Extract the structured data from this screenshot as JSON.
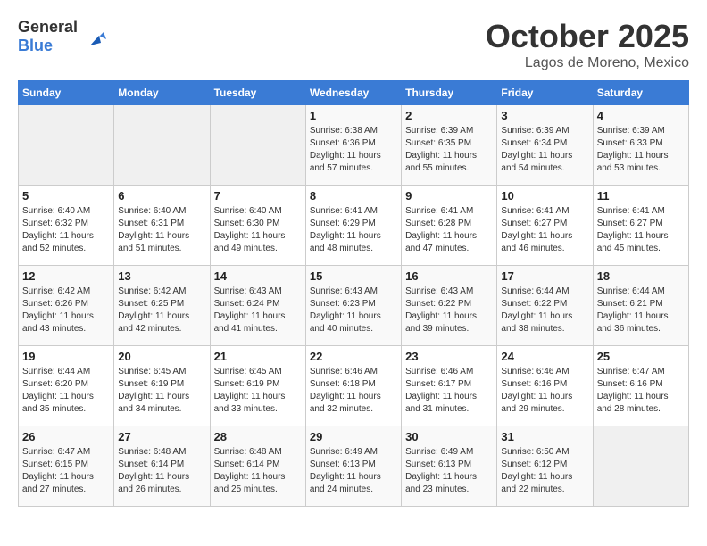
{
  "header": {
    "logo_general": "General",
    "logo_blue": "Blue",
    "month": "October 2025",
    "location": "Lagos de Moreno, Mexico"
  },
  "days_of_week": [
    "Sunday",
    "Monday",
    "Tuesday",
    "Wednesday",
    "Thursday",
    "Friday",
    "Saturday"
  ],
  "weeks": [
    [
      {
        "day": "",
        "info": ""
      },
      {
        "day": "",
        "info": ""
      },
      {
        "day": "",
        "info": ""
      },
      {
        "day": "1",
        "info": "Sunrise: 6:38 AM\nSunset: 6:36 PM\nDaylight: 11 hours and 57 minutes."
      },
      {
        "day": "2",
        "info": "Sunrise: 6:39 AM\nSunset: 6:35 PM\nDaylight: 11 hours and 55 minutes."
      },
      {
        "day": "3",
        "info": "Sunrise: 6:39 AM\nSunset: 6:34 PM\nDaylight: 11 hours and 54 minutes."
      },
      {
        "day": "4",
        "info": "Sunrise: 6:39 AM\nSunset: 6:33 PM\nDaylight: 11 hours and 53 minutes."
      }
    ],
    [
      {
        "day": "5",
        "info": "Sunrise: 6:40 AM\nSunset: 6:32 PM\nDaylight: 11 hours and 52 minutes."
      },
      {
        "day": "6",
        "info": "Sunrise: 6:40 AM\nSunset: 6:31 PM\nDaylight: 11 hours and 51 minutes."
      },
      {
        "day": "7",
        "info": "Sunrise: 6:40 AM\nSunset: 6:30 PM\nDaylight: 11 hours and 49 minutes."
      },
      {
        "day": "8",
        "info": "Sunrise: 6:41 AM\nSunset: 6:29 PM\nDaylight: 11 hours and 48 minutes."
      },
      {
        "day": "9",
        "info": "Sunrise: 6:41 AM\nSunset: 6:28 PM\nDaylight: 11 hours and 47 minutes."
      },
      {
        "day": "10",
        "info": "Sunrise: 6:41 AM\nSunset: 6:27 PM\nDaylight: 11 hours and 46 minutes."
      },
      {
        "day": "11",
        "info": "Sunrise: 6:41 AM\nSunset: 6:27 PM\nDaylight: 11 hours and 45 minutes."
      }
    ],
    [
      {
        "day": "12",
        "info": "Sunrise: 6:42 AM\nSunset: 6:26 PM\nDaylight: 11 hours and 43 minutes."
      },
      {
        "day": "13",
        "info": "Sunrise: 6:42 AM\nSunset: 6:25 PM\nDaylight: 11 hours and 42 minutes."
      },
      {
        "day": "14",
        "info": "Sunrise: 6:43 AM\nSunset: 6:24 PM\nDaylight: 11 hours and 41 minutes."
      },
      {
        "day": "15",
        "info": "Sunrise: 6:43 AM\nSunset: 6:23 PM\nDaylight: 11 hours and 40 minutes."
      },
      {
        "day": "16",
        "info": "Sunrise: 6:43 AM\nSunset: 6:22 PM\nDaylight: 11 hours and 39 minutes."
      },
      {
        "day": "17",
        "info": "Sunrise: 6:44 AM\nSunset: 6:22 PM\nDaylight: 11 hours and 38 minutes."
      },
      {
        "day": "18",
        "info": "Sunrise: 6:44 AM\nSunset: 6:21 PM\nDaylight: 11 hours and 36 minutes."
      }
    ],
    [
      {
        "day": "19",
        "info": "Sunrise: 6:44 AM\nSunset: 6:20 PM\nDaylight: 11 hours and 35 minutes."
      },
      {
        "day": "20",
        "info": "Sunrise: 6:45 AM\nSunset: 6:19 PM\nDaylight: 11 hours and 34 minutes."
      },
      {
        "day": "21",
        "info": "Sunrise: 6:45 AM\nSunset: 6:19 PM\nDaylight: 11 hours and 33 minutes."
      },
      {
        "day": "22",
        "info": "Sunrise: 6:46 AM\nSunset: 6:18 PM\nDaylight: 11 hours and 32 minutes."
      },
      {
        "day": "23",
        "info": "Sunrise: 6:46 AM\nSunset: 6:17 PM\nDaylight: 11 hours and 31 minutes."
      },
      {
        "day": "24",
        "info": "Sunrise: 6:46 AM\nSunset: 6:16 PM\nDaylight: 11 hours and 29 minutes."
      },
      {
        "day": "25",
        "info": "Sunrise: 6:47 AM\nSunset: 6:16 PM\nDaylight: 11 hours and 28 minutes."
      }
    ],
    [
      {
        "day": "26",
        "info": "Sunrise: 6:47 AM\nSunset: 6:15 PM\nDaylight: 11 hours and 27 minutes."
      },
      {
        "day": "27",
        "info": "Sunrise: 6:48 AM\nSunset: 6:14 PM\nDaylight: 11 hours and 26 minutes."
      },
      {
        "day": "28",
        "info": "Sunrise: 6:48 AM\nSunset: 6:14 PM\nDaylight: 11 hours and 25 minutes."
      },
      {
        "day": "29",
        "info": "Sunrise: 6:49 AM\nSunset: 6:13 PM\nDaylight: 11 hours and 24 minutes."
      },
      {
        "day": "30",
        "info": "Sunrise: 6:49 AM\nSunset: 6:13 PM\nDaylight: 11 hours and 23 minutes."
      },
      {
        "day": "31",
        "info": "Sunrise: 6:50 AM\nSunset: 6:12 PM\nDaylight: 11 hours and 22 minutes."
      },
      {
        "day": "",
        "info": ""
      }
    ]
  ]
}
